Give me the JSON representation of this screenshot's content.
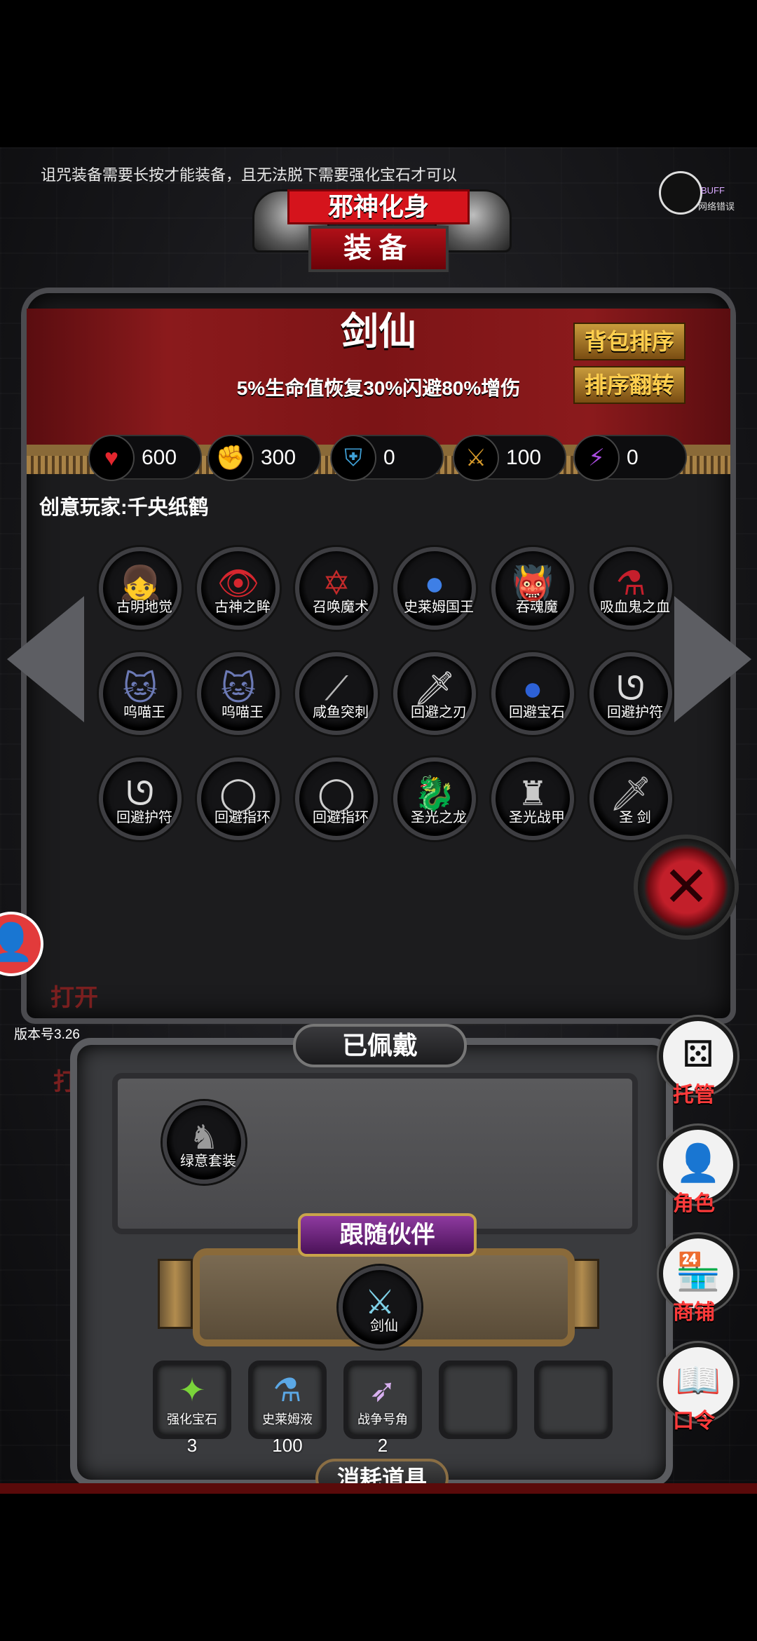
{
  "tip": "诅咒装备需要长按才能装备，且无法脱下需要强化宝石才可以",
  "buff": {
    "line1": "BUFF",
    "line2": "网络错误"
  },
  "banner": {
    "top": "邪神化身",
    "main": "装备"
  },
  "hero": {
    "name": "剑仙",
    "desc": "5%生命值恢复30%闪避80%增伤"
  },
  "buttons": {
    "sort_bag": "背包排序",
    "sort_flip": "排序翻转"
  },
  "stats": [
    {
      "icon": "heart-icon",
      "glyph": "♥",
      "color": "#e3262e",
      "value": "600"
    },
    {
      "icon": "strength-icon",
      "glyph": "✊",
      "color": "#d9b336",
      "value": "300"
    },
    {
      "icon": "armor-icon",
      "glyph": "⛨",
      "color": "#3fa0d6",
      "value": "0"
    },
    {
      "icon": "sword-icon",
      "glyph": "⚔",
      "color": "#d79a2a",
      "value": "100"
    },
    {
      "icon": "lightning-icon",
      "glyph": "⚡",
      "color": "#a94ce0",
      "value": "0"
    }
  ],
  "player": "创意玩家:千央纸鹤",
  "inventory": [
    {
      "label": "古明地觉",
      "glyph": "👧",
      "color": "#c98ee6"
    },
    {
      "label": "古神之眸",
      "glyph": "👁",
      "color": "#d6262e"
    },
    {
      "label": "召唤魔术",
      "glyph": "✡",
      "color": "#c42a2a"
    },
    {
      "label": "史莱姆国王",
      "glyph": "●",
      "color": "#3e7fe6"
    },
    {
      "label": "吞魂魔",
      "glyph": "👹",
      "color": "#d9342c"
    },
    {
      "label": "吸血鬼之血",
      "glyph": "⚗",
      "color": "#c51f2c"
    },
    {
      "label": "呜喵王",
      "glyph": "🐱",
      "color": "#6c7ab6"
    },
    {
      "label": "呜喵王",
      "glyph": "🐱",
      "color": "#6c7ab6"
    },
    {
      "label": "咸鱼突刺",
      "glyph": "⟋",
      "color": "#b7b7b7"
    },
    {
      "label": "回避之刃",
      "glyph": "🗡",
      "color": "#dcdcdc"
    },
    {
      "label": "回避宝石",
      "glyph": "●",
      "color": "#2d61d6"
    },
    {
      "label": "回避护符",
      "glyph": "ᘎ",
      "color": "#dddddd"
    },
    {
      "label": "回避护符",
      "glyph": "ᘎ",
      "color": "#dddddd"
    },
    {
      "label": "回避指环",
      "glyph": "◯",
      "color": "#cfcfcf"
    },
    {
      "label": "回避指环",
      "glyph": "◯",
      "color": "#cfcfcf"
    },
    {
      "label": "圣光之龙",
      "glyph": "🐉",
      "color": "#e5b22a"
    },
    {
      "label": "圣光战甲",
      "glyph": "♜",
      "color": "#c8c8c8"
    },
    {
      "label": "圣 剑",
      "glyph": "🗡",
      "color": "#bdbdbd"
    }
  ],
  "version": "版本号3.26",
  "worn": {
    "title": "已佩戴",
    "item": {
      "label": "绿意套装",
      "glyph": "♞",
      "color": "#9a9a9a"
    }
  },
  "follow": {
    "title": "跟随伙伴",
    "item": {
      "label": "剑仙",
      "glyph": "⚔",
      "color": "#7fd0e6"
    }
  },
  "consumables": {
    "title": "消耗道具",
    "items": [
      {
        "label": "强化宝石",
        "glyph": "✦",
        "color": "#7ad43a",
        "count": "3"
      },
      {
        "label": "史莱姆液",
        "glyph": "⚗",
        "color": "#5ba8e6",
        "count": "100"
      },
      {
        "label": "战争号角",
        "glyph": "➶",
        "color": "#d8b0f0",
        "count": "2"
      }
    ]
  },
  "right_menu": [
    {
      "label": "托管",
      "icon": "dice-icon",
      "glyph": "⚄"
    },
    {
      "label": "角色",
      "icon": "character-icon",
      "glyph": "👤"
    },
    {
      "label": "商铺",
      "icon": "shop-icon",
      "glyph": "🏪"
    },
    {
      "label": "口令",
      "icon": "code-book-icon",
      "glyph": "📖"
    }
  ],
  "behind": {
    "line1": "打开",
    "line2": "打"
  }
}
